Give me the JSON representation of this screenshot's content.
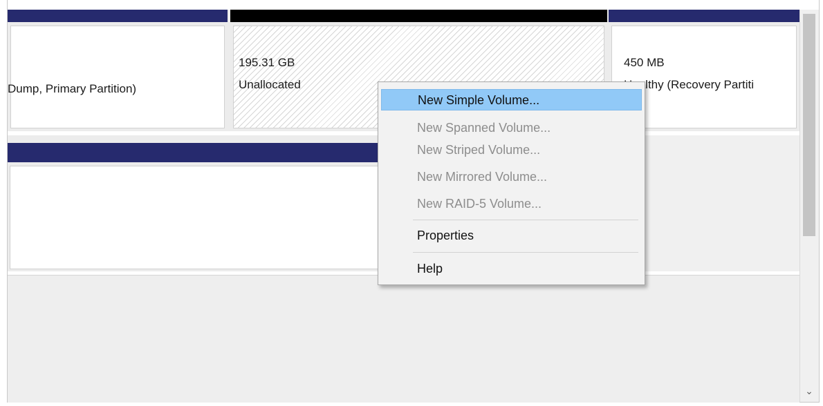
{
  "disk_top": {
    "partition_left": {
      "line1": "Dump, Primary Partition)"
    },
    "partition_unallocated": {
      "size": "195.31 GB",
      "status": "Unallocated"
    },
    "partition_recovery": {
      "size": "450 MB",
      "status": "Healthy (Recovery Partiti"
    }
  },
  "context_menu": {
    "items": [
      {
        "label": "New Simple Volume...",
        "enabled": true,
        "highlighted": true
      },
      {
        "label": "New Spanned Volume...",
        "enabled": false
      },
      {
        "label": "New Striped Volume...",
        "enabled": false
      },
      {
        "label": "New Mirrored Volume...",
        "enabled": false
      },
      {
        "label": "New RAID-5 Volume...",
        "enabled": false
      },
      {
        "label": "Properties",
        "enabled": true
      },
      {
        "label": "Help",
        "enabled": true
      }
    ]
  },
  "scrollbar": {
    "down_arrow_icon": "chevron-down-icon",
    "down_arrow_glyph": "⌄"
  },
  "colors": {
    "partition_bar_primary": "#262a6e",
    "partition_bar_unallocated": "#000000",
    "menu_highlight": "#91c9f7"
  }
}
